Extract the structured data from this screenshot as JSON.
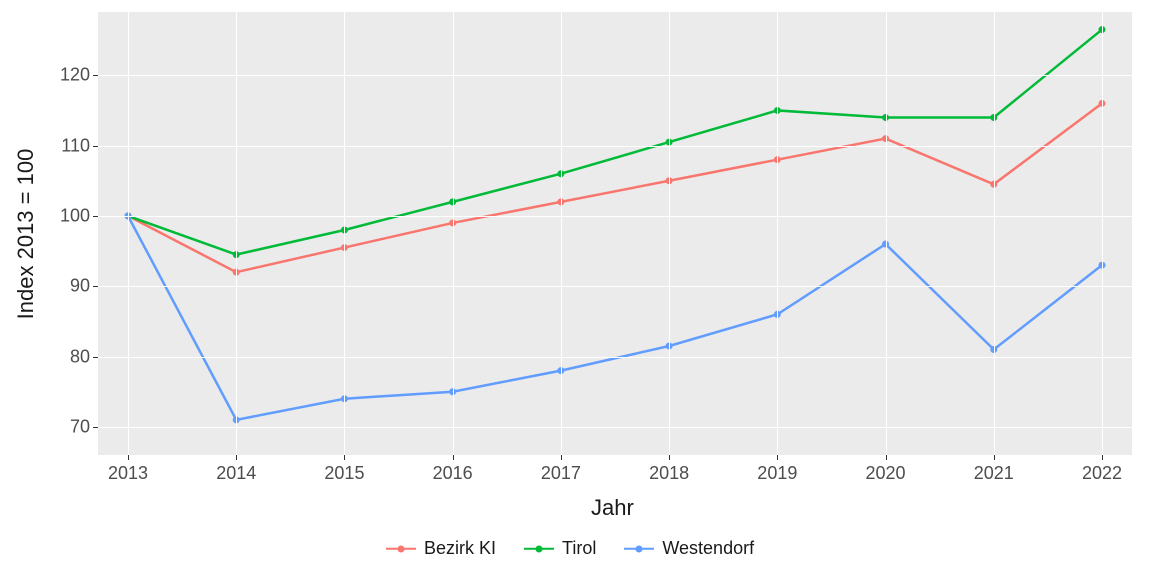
{
  "chart_data": {
    "type": "line",
    "xlabel": "Jahr",
    "ylabel": "Index  2013  =  100",
    "categories": [
      2013,
      2014,
      2015,
      2016,
      2017,
      2018,
      2019,
      2020,
      2021,
      2022
    ],
    "y_ticks": [
      70,
      80,
      90,
      100,
      110,
      120
    ],
    "ylim": [
      66,
      129
    ],
    "series": [
      {
        "name": "Bezirk KI",
        "color": "#F8766D",
        "values": [
          100,
          92,
          95.5,
          99,
          102,
          105,
          108,
          111,
          104.5,
          116
        ]
      },
      {
        "name": "Tirol",
        "color": "#00BA38",
        "values": [
          100,
          94.5,
          98,
          102,
          106,
          110.5,
          115,
          114,
          114,
          126.5
        ]
      },
      {
        "name": "Westendorf",
        "color": "#619CFF",
        "values": [
          100,
          71,
          74,
          75,
          78,
          81.5,
          86,
          96,
          81,
          93
        ]
      }
    ]
  }
}
